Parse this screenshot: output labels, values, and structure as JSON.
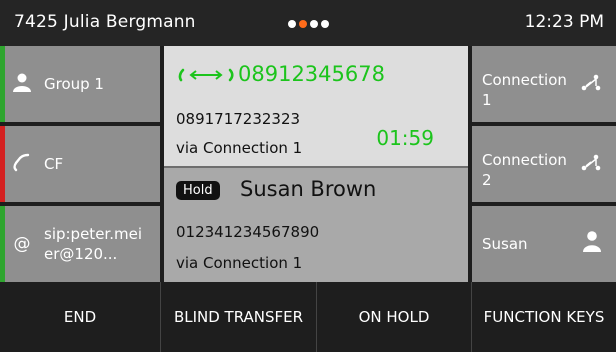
{
  "status_bar": {
    "user": "7425 Julia Bergmann",
    "time": "12:23 PM",
    "page_dots": 4,
    "active_dot": 1
  },
  "left_keys": [
    {
      "label": "Group 1",
      "icon": "user-icon",
      "bar_color": "#2ea52e"
    },
    {
      "label": "CF",
      "icon": "call-forward-icon",
      "bar_color": "#d42020"
    },
    {
      "label_lines": [
        "sip:peter.mei",
        "er@120..."
      ],
      "icon": "at-icon",
      "bar_color": "#2ea52e"
    }
  ],
  "active_call": {
    "number": "08912345678",
    "caller_number": "0891717232323",
    "via": "via Connection 1",
    "duration": "01:59",
    "accent_color": "#1cc41c"
  },
  "held_call": {
    "badge": "Hold",
    "name": "Susan Brown",
    "number": "012341234567890",
    "via": "via Connection 1"
  },
  "right_keys": [
    {
      "label_lines": [
        "Connection",
        "1"
      ],
      "icon": "connection-icon"
    },
    {
      "label_lines": [
        "Connection",
        "2"
      ],
      "icon": "connection-icon"
    },
    {
      "label_lines": [
        "Susan"
      ],
      "icon": "user-icon"
    }
  ],
  "softkeys": [
    "END",
    "BLIND TRANSFER",
    "ON HOLD",
    "FUNCTION KEYS"
  ]
}
